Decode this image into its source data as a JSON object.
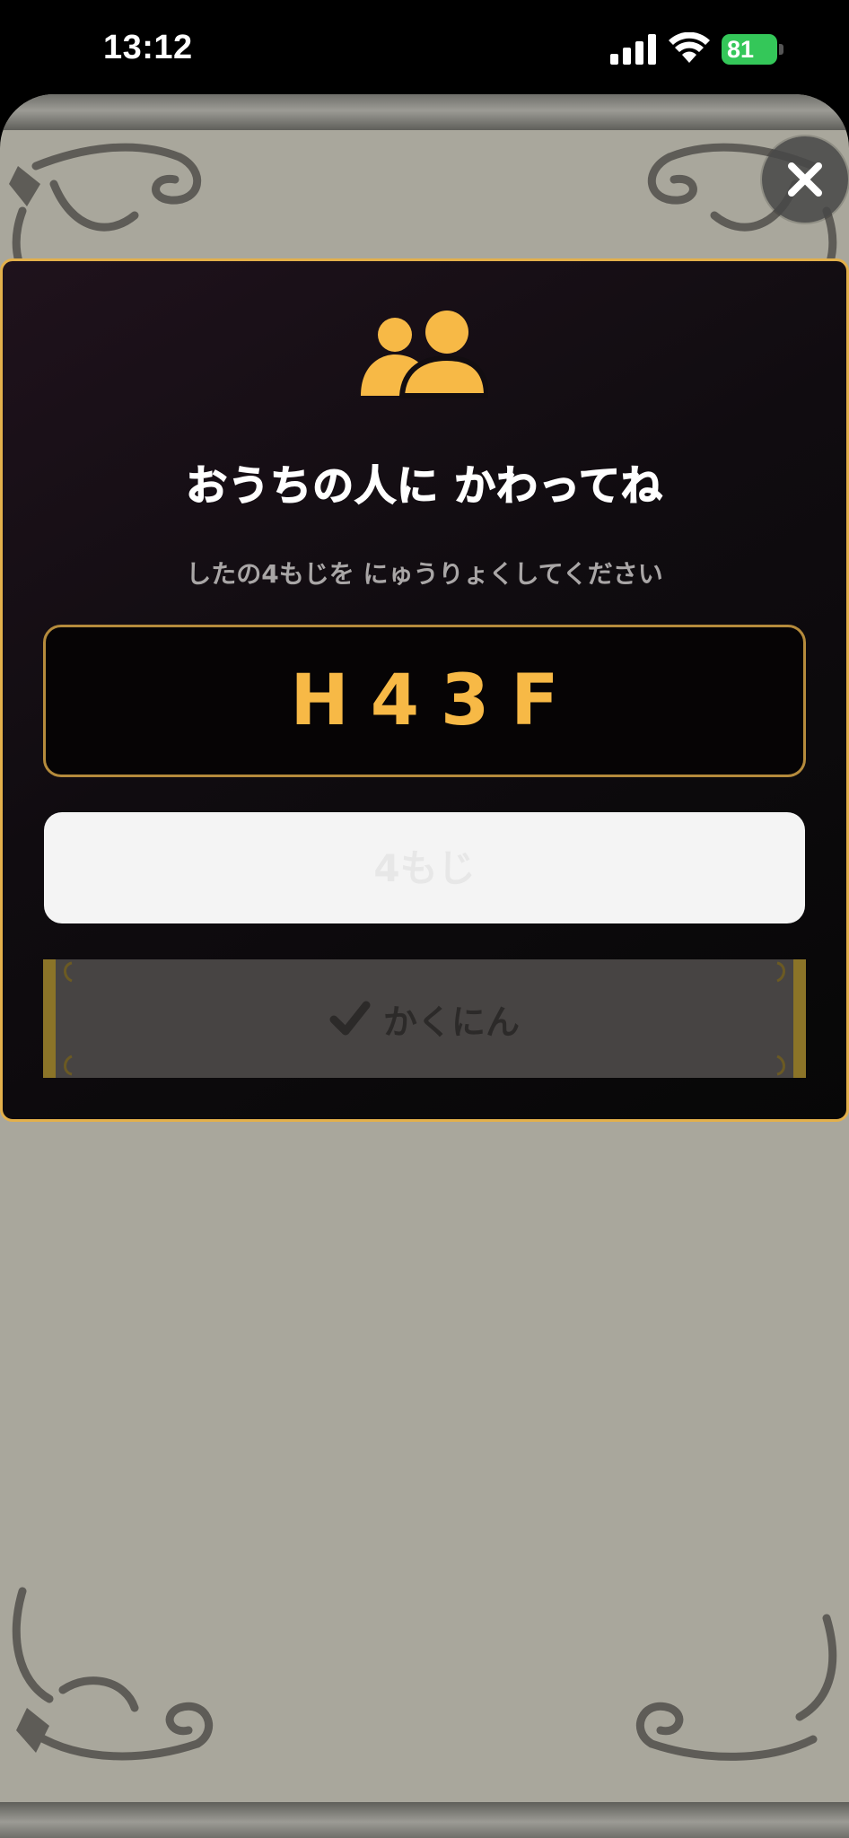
{
  "status_bar": {
    "time": "13:12",
    "battery_percent": "81",
    "icons": [
      "signal-icon",
      "wifi-icon",
      "battery-icon"
    ]
  },
  "modal": {
    "icon": "group-icon",
    "title": "おうちの人に かわってね",
    "subtitle": "したの4もじを にゅうりょくしてください",
    "code": "H43F",
    "input": {
      "value": "",
      "placeholder": "4もじ"
    },
    "confirm_button": {
      "icon": "check-icon",
      "label": "かくにん"
    }
  },
  "close_button": {
    "icon": "close-icon"
  },
  "colors": {
    "accent": "#f7b946",
    "modal_border": "#e3b04b",
    "battery": "#34c759",
    "sheet": "#a9a79c"
  }
}
